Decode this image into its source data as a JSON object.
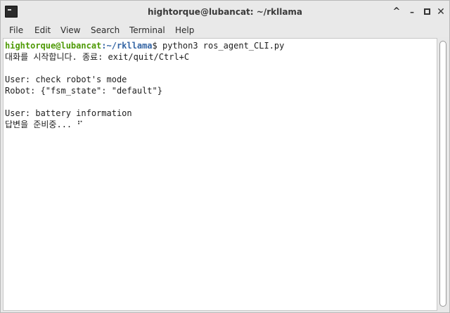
{
  "window": {
    "title": "hightorque@lubancat: ~/rkllama",
    "controls": {
      "shade": "^",
      "minimize": "–",
      "close": "✕"
    }
  },
  "menu": [
    "File",
    "Edit",
    "View",
    "Search",
    "Terminal",
    "Help"
  ],
  "terminal": {
    "prompt_user": "hightorque@lubancat",
    "prompt_path": ":~/rkllama",
    "prompt_cmd": "$ python3 ros_agent_CLI.py",
    "lines": [
      "대화를 시작합니다. 종료: exit/quit/Ctrl+C",
      "",
      "User: check robot's mode",
      "Robot: {\"fsm_state\": \"default\"}",
      "",
      "User: battery information",
      "답변을 준비중... ⠋"
    ]
  },
  "colors": {
    "prompt_user": "#4e9a06",
    "prompt_path": "#3465a4",
    "background": "#ffffff"
  },
  "icons": {
    "app": "terminal-icon"
  }
}
